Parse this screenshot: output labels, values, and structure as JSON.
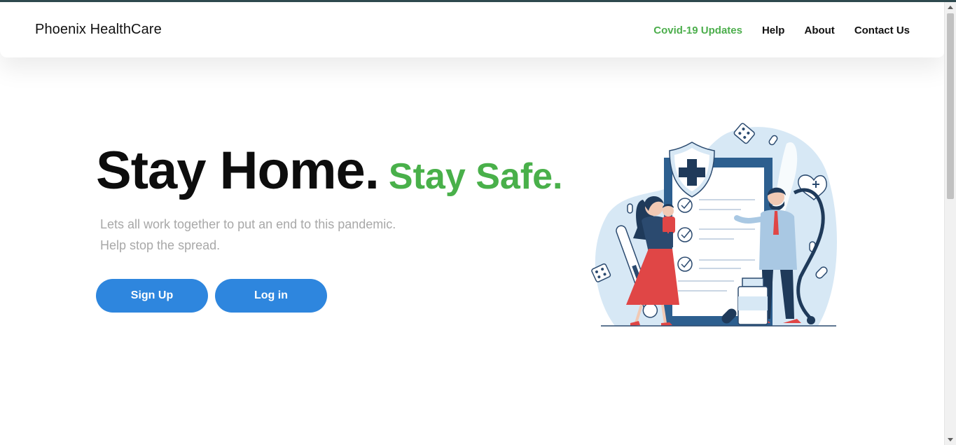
{
  "brand": {
    "name": "Phoenix HealthCare"
  },
  "nav": {
    "items": [
      {
        "label": "Covid-19 Updates",
        "active": true
      },
      {
        "label": "Help",
        "active": false
      },
      {
        "label": "About",
        "active": false
      },
      {
        "label": "Contact Us",
        "active": false
      }
    ]
  },
  "hero": {
    "title_main": "Stay Home.",
    "title_accent": "Stay Safe.",
    "subtitle_line1": "Lets all work together to put an end to this pandemic.",
    "subtitle_line2": "Help stop the spread.",
    "signup_label": "Sign Up",
    "login_label": "Log in"
  },
  "colors": {
    "accent_green": "#49b04a",
    "button_blue": "#2e86de",
    "top_bar": "#2f4a4f"
  },
  "icons": [
    "chevron-up-icon",
    "chevron-down-icon"
  ]
}
